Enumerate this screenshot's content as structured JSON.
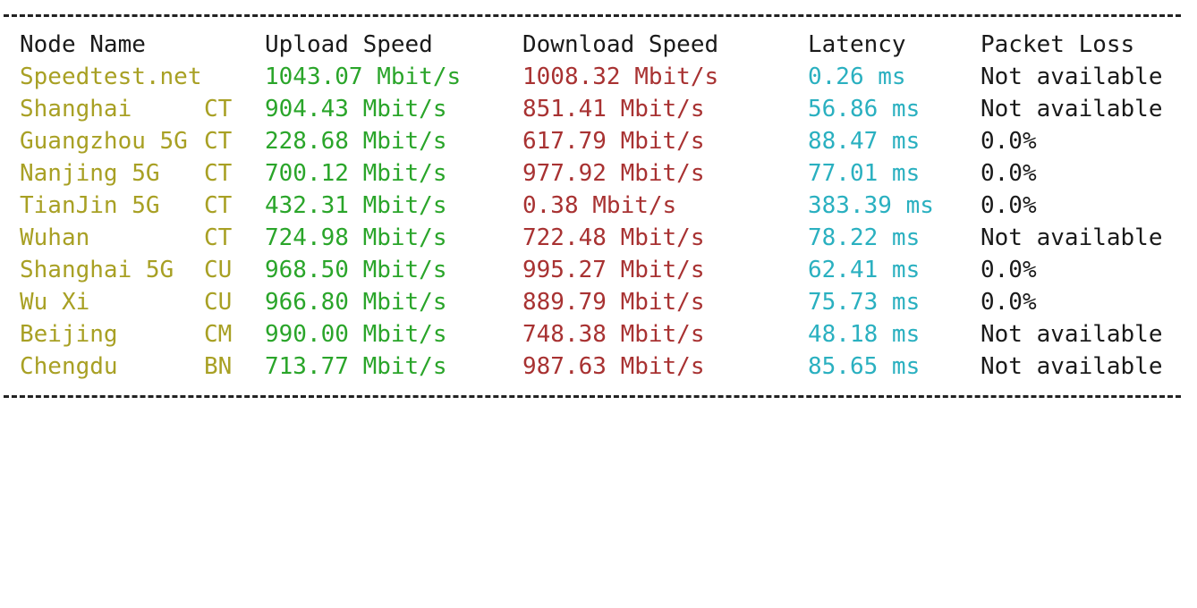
{
  "colors": {
    "header": "#1a1a1a",
    "node": "#a8a024",
    "upload": "#2aa52a",
    "download": "#a83232",
    "latency": "#2ab0c0",
    "loss": "#1a1a1a",
    "separator": "#222222"
  },
  "header": {
    "node_name": "Node Name",
    "upload": "Upload Speed",
    "download": "Download Speed",
    "latency": "Latency",
    "loss": "Packet Loss"
  },
  "rows": [
    {
      "node": "Speedtest.net",
      "isp": "",
      "upload": "1043.07 Mbit/s",
      "download": "1008.32 Mbit/s",
      "latency": "0.26 ms",
      "loss": "Not available"
    },
    {
      "node": "Shanghai",
      "isp": "CT",
      "upload": "904.43 Mbit/s",
      "download": "851.41 Mbit/s",
      "latency": "56.86 ms",
      "loss": "Not available"
    },
    {
      "node": "Guangzhou 5G",
      "isp": "CT",
      "upload": "228.68 Mbit/s",
      "download": "617.79 Mbit/s",
      "latency": "88.47 ms",
      "loss": "0.0%"
    },
    {
      "node": "Nanjing 5G",
      "isp": "CT",
      "upload": "700.12 Mbit/s",
      "download": "977.92 Mbit/s",
      "latency": "77.01 ms",
      "loss": "0.0%"
    },
    {
      "node": "TianJin 5G",
      "isp": "CT",
      "upload": "432.31 Mbit/s",
      "download": "0.38 Mbit/s",
      "latency": "383.39 ms",
      "loss": "0.0%"
    },
    {
      "node": "Wuhan",
      "isp": "CT",
      "upload": "724.98 Mbit/s",
      "download": "722.48 Mbit/s",
      "latency": "78.22 ms",
      "loss": "Not available"
    },
    {
      "node": "Shanghai 5G",
      "isp": "CU",
      "upload": "968.50 Mbit/s",
      "download": "995.27 Mbit/s",
      "latency": "62.41 ms",
      "loss": "0.0%"
    },
    {
      "node": "Wu Xi",
      "isp": "CU",
      "upload": "966.80 Mbit/s",
      "download": "889.79 Mbit/s",
      "latency": "75.73 ms",
      "loss": "0.0%"
    },
    {
      "node": "Beijing",
      "isp": "CM",
      "upload": "990.00 Mbit/s",
      "download": "748.38 Mbit/s",
      "latency": "48.18 ms",
      "loss": "Not available"
    },
    {
      "node": "Chengdu",
      "isp": "BN",
      "upload": "713.77 Mbit/s",
      "download": "987.63 Mbit/s",
      "latency": "85.65 ms",
      "loss": "Not available"
    }
  ]
}
